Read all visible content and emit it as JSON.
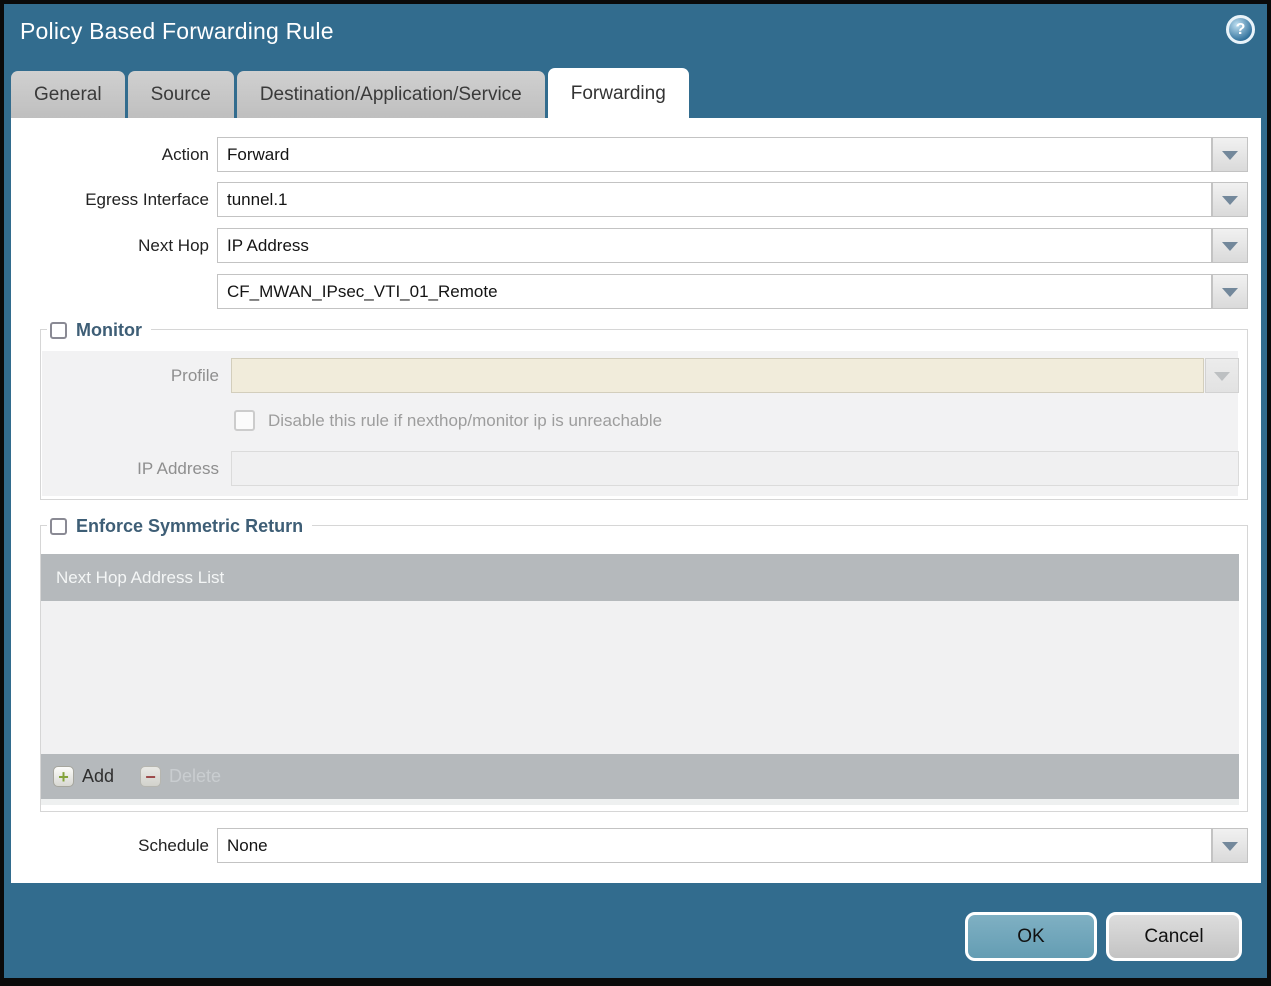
{
  "dialog": {
    "title": "Policy Based Forwarding Rule"
  },
  "icons": {
    "help": "?",
    "add_plus": "+",
    "delete_minus": "−"
  },
  "tabs": [
    {
      "label": "General",
      "active": false
    },
    {
      "label": "Source",
      "active": false
    },
    {
      "label": "Destination/Application/Service",
      "active": false
    },
    {
      "label": "Forwarding",
      "active": true
    }
  ],
  "form": {
    "action": {
      "label": "Action",
      "value": "Forward"
    },
    "egress_interface": {
      "label": "Egress Interface",
      "value": "tunnel.1"
    },
    "next_hop": {
      "label": "Next Hop",
      "value": "IP Address"
    },
    "next_hop_address": {
      "value": "CF_MWAN_IPsec_VTI_01_Remote"
    },
    "schedule": {
      "label": "Schedule",
      "value": "None"
    }
  },
  "monitor": {
    "label": "Monitor",
    "checked": false,
    "profile": {
      "label": "Profile",
      "value": ""
    },
    "disable_rule": {
      "label": "Disable this rule if nexthop/monitor ip is unreachable",
      "checked": false
    },
    "ip_address": {
      "label": "IP Address",
      "value": ""
    }
  },
  "symmetric_return": {
    "label": "Enforce Symmetric Return",
    "checked": false,
    "table": {
      "header": "Next Hop Address List",
      "rows": []
    },
    "add_label": "Add",
    "delete_label": "Delete"
  },
  "footer": {
    "ok_label": "OK",
    "cancel_label": "Cancel"
  },
  "colors": {
    "titlebar": "#326c8e",
    "active_tab": "#ffffff",
    "inactive_tab": "#c6c6c6",
    "disabled_field_beige": "#f1ecdb",
    "table_header_gray": "#b5b9bc",
    "ok_button": "#6fa6bb",
    "cancel_button": "#cccccc"
  }
}
